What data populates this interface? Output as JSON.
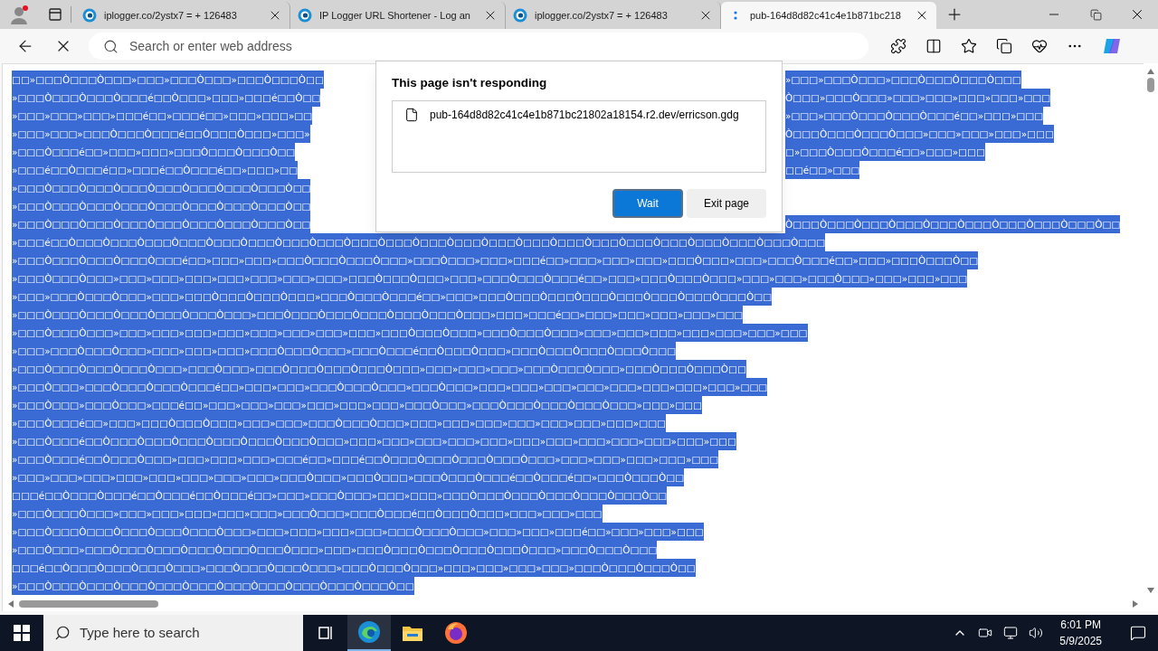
{
  "browser": {
    "tabs": [
      {
        "title": "iplogger.co/2ystx7 = + 126483",
        "selected": false,
        "loading": false
      },
      {
        "title": "IP Logger URL Shortener - Log an",
        "selected": false,
        "loading": false
      },
      {
        "title": "iplogger.co/2ystx7 = + 126483",
        "selected": false,
        "loading": false
      },
      {
        "title": "pub-164d8d82c41c4e1b871bc218",
        "selected": true,
        "loading": true
      }
    ],
    "loading": true,
    "address_bar": {
      "placeholder": "Search or enter web address"
    }
  },
  "page": {
    "selected": true,
    "lines": [
      {
        "segments": [
          "□□»□□□Ò□□□Ò□□□»□□□»□□□Ò□□□»□□□Ò□□□Ò□□",
          "»□□□»□□□Ò□□□»□□□Ò□□□Ò□□□Ò□□□"
        ]
      },
      {
        "segments": [
          "»□□□Ò□□□Ò□□□Ò□□□é□□Ò□□□»□□□»□□□é□□Ò□□",
          "Ò□□□»□□□Ò□□□»□□□»□□□»□□□»□□□»□□□"
        ]
      },
      {
        "segments": [
          "»□□□»□□□»□□□»□□□é□□»□□□é□□»□□□»□□□»□□",
          "»□□□»□□□Ò□□□Ò□□□Ò□□□é□□»□□□»□□□"
        ]
      },
      {
        "segments": [
          "»□□□»□□□»□□□Ò□□□Ò□□□é□□Ò□□□Ò□□□»□□□»",
          "Ò□□□Ò□□□Ò□□□Ò□□□»□□□»□□□»□□□»□□□"
        ]
      },
      {
        "segments": [
          "»□□□Ò□□□é□□»□□□»□□□»□□□Ò□□□Ò□□□Ò□□",
          "□»□□□Ò□□□Ò□□□é□□»□□□»□□□"
        ]
      },
      {
        "segments": [
          "»□□□é□□Ò□□□é□□»□□□é□□Ò□□□é□□»□□□»□□",
          "□□é□□»□□□"
        ]
      },
      {
        "segments": [
          "»□□□Ò□□□Ò□□□Ò□□□Ò□□□Ò□□□Ò□□□Ò□□□Ò□□"
        ]
      },
      {
        "segments": [
          "»□□□Ò□□□Ò□□□Ò□□□Ò□□□Ò□□□Ò□□□Ò□□□Ò□□"
        ]
      },
      {
        "segments": [
          "»□□□Ò□□□Ò□□□Ò□□□Ò□□□Ò□□□Ò□□□Ò□□□Ò□□",
          "Ò□□□Ò□□□Ò□□□Ò□□□Ò□□□Ò□□□Ò□□□Ò□□□Ò□□□Ò□□"
        ]
      },
      {
        "segments": [
          "»□□□é□□Ò□□□Ò□□□Ò□□□Ò□□□Ò□□□Ò□□□Ò□□□Ò□□□Ò□□□Ò□□□Ò□□□Ò□□□Ò□□□Ò□□□Ò□□□Ò□□□Ò□□□Ò□□□Ò□□□Ò□□□Ò□□□Ò□□□"
        ]
      },
      {
        "segments": [
          "»□□□Ò□□□Ò□□□Ò□□□Ò□□□é□□»□□□»□□□»□□□Ò□□□Ò□□□Ò□□□»□□□Ò□□□»□□□»□□□é□□»□□□»□□□»□□□»□□□Ò□□□»□□□»□□□Ò□□□é□□»□□□»□□□Ò□□□Ò□□"
        ]
      },
      {
        "segments": [
          "»□□□Ò□□□Ò□□□»□□□»□□□»□□□»□□□»□□□»□□□»□□□»□□□Ò□□□Ò□□□»□□□»□□□Ò□□□Ò□□□é□□»□□□»□□□Ò□□□Ò□□□»□□□»□□□»□□□Ò□□□»□□□»□□□»□□□"
        ]
      },
      {
        "segments": [
          "»□□□»□□□Ò□□□Ò□□□»□□□»□□□Ò□□□Ò□□□Ò□□□»□□□Ò□□□Ò□□□é□□»□□□»□□□Ò□□□Ò□□□Ò□□□Ò□□□Ò□□□Ò□□□Ò□□□Ò□□"
        ]
      },
      {
        "segments": [
          "»□□□Ò□□□Ò□□□Ò□□□Ò□□□Ò□□□Ò□□□»□□□Ò□□□Ò□□□Ò□□□Ò□□□Ò□□□Ò□□□»□□□»□□□é□□»□□□»□□□»□□□»□□□»□□□"
        ]
      },
      {
        "segments": [
          "»□□□Ò□□□Ò□□□»□□□»□□□»□□□»□□□»□□□»□□□»□□□»□□□»□□□Ò□□□Ò□□□»□□□Ò□□□Ò□□□»□□□»□□□»□□□»□□□»□□□»□□□»□□□"
        ]
      },
      {
        "segments": [
          "»□□□»□□□Ò□□□Ò□□□»□□□»□□□»□□□»□□□Ò□□□Ò□□□»□□□Ò□□□é□□Ò□□□Ò□□□»□□□Ò□□□Ò□□□Ò□□□Ò□□□"
        ]
      },
      {
        "segments": [
          "»□□□Ò□□□Ò□□□Ò□□□Ò□□□»□□□Ò□□□»□□□Ò□□□Ò□□□Ò□□□Ò□□□»□□□»□□□»□□□»□□□Ò□□□Ò□□□»□□□Ò□□□Ò□□□Ò□□"
        ]
      },
      {
        "segments": [
          "»□□□Ò□□□»□□□Ò□□□Ò□□□Ò□□□é□□»□□□»□□□»□□□Ò□□□Ò□□□»□□□Ò□□□»□□□»□□□»□□□»□□□»□□□»□□□»□□□»□□□»□□□"
        ]
      },
      {
        "segments": [
          "»□□□Ò□□□»□□□Ò□□□»□□□é□□»□□□»□□□»□□□»□□□»□□□»□□□»□□□Ò□□□»□□□Ò□□□Ò□□□Ò□□□Ò□□□»□□□»□□□"
        ]
      },
      {
        "segments": [
          "»□□□Ò□□□é□□»□□□»□□□Ò□□□Ò□□□»□□□»□□□»□□□Ò□□□Ò□□□»□□□»□□□»□□□»□□□»□□□»□□□»□□□»□□□"
        ]
      },
      {
        "segments": [
          "»□□□Ò□□□é□□Ò□□□Ò□□□Ò□□□Ò□□□Ò□□□Ò□□□Ò□□□»□□□»□□□»□□□»□□□»□□□»□□□»□□□»□□□»□□□»□□□»□□□»□□□"
        ]
      },
      {
        "segments": [
          "»□□□Ò□□□é□□Ò□□□Ò□□□»□□□»□□□»□□□»□□□é□□»□□□é□□Ò□□□Ò□□□Ò□□□Ò□□□Ò□□□»□□□»□□□»□□□»□□□»□□□"
        ]
      },
      {
        "segments": [
          "»□□□»□□□»□□□»□□□»□□□»□□□»□□□»□□□»□□□Ò□□□»□□□Ò□□□»□□□Ò□□□Ò□□□é□□Ò□□□é□□»□□□Ò□□□Ò□□"
        ]
      },
      {
        "segments": [
          "□□□é□□Ò□□□Ò□□□é□□Ò□□□é□□Ò□□□é□□»□□□»□□□Ò□□□»□□□»□□□»□□□Ò□□□Ò□□□Ò□□□Ò□□□Ò□□□Ò□□"
        ]
      },
      {
        "segments": [
          "»□□□Ò□□□Ò□□□»□□□»□□□»□□□»□□□»□□□»□□□Ò□□□»□□□Ò□□□é□□Ò□□□Ò□□□»□□□»□□□»□□□"
        ]
      },
      {
        "segments": [
          "»□□□Ò□□□Ò□□□Ò□□□Ò□□□Ò□□□Ò□□□»□□□»□□□»□□□»□□□»□□□Ò□□□Ò□□□»□□□»□□□»□□□é□□»□□□»□□□»□□□"
        ]
      },
      {
        "segments": [
          "»□□□Ò□□□»□□□Ò□□□Ò□□□Ò□□□Ò□□□Ò□□□Ò□□□»□□□»□□□Ò□□□Ò□□□Ò□□□Ò□□□Ò□□□»□□□Ò□□□Ò□□□"
        ]
      },
      {
        "segments": [
          "□□□é□□Ò□□□Ò□□□Ò□□□Ò□□□»□□□Ò□□□Ò□□□Ò□□□»□□□Ò□□□Ò□□□»□□□»□□□»□□□»□□□»□□□Ò□□□Ò□□□Ò□□"
        ]
      },
      {
        "segments": [
          "»□□□Ò□□□Ò□□□Ò□□□Ò□□□Ò□□□Ò□□□Ò□□□Ò□□□Ò□□□Ò□□□Ò□□"
        ]
      }
    ]
  },
  "dialog": {
    "title": "This page isn't responding",
    "pages": [
      "pub-164d8d82c41c4e1b871bc21802a18154.r2.dev/erricson.gdg"
    ],
    "buttons": [
      {
        "label": "Wait",
        "primary": true
      },
      {
        "label": "Exit page",
        "primary": false
      }
    ]
  },
  "taskbar": {
    "search_placeholder": "Type here to search",
    "apps": [
      {
        "kind": "task-view",
        "selected": false
      },
      {
        "kind": "edge",
        "selected": true
      },
      {
        "kind": "explorer",
        "selected": false
      },
      {
        "kind": "firefox",
        "selected": false
      }
    ],
    "time": "6:01 PM",
    "date": "5/9/2025"
  }
}
